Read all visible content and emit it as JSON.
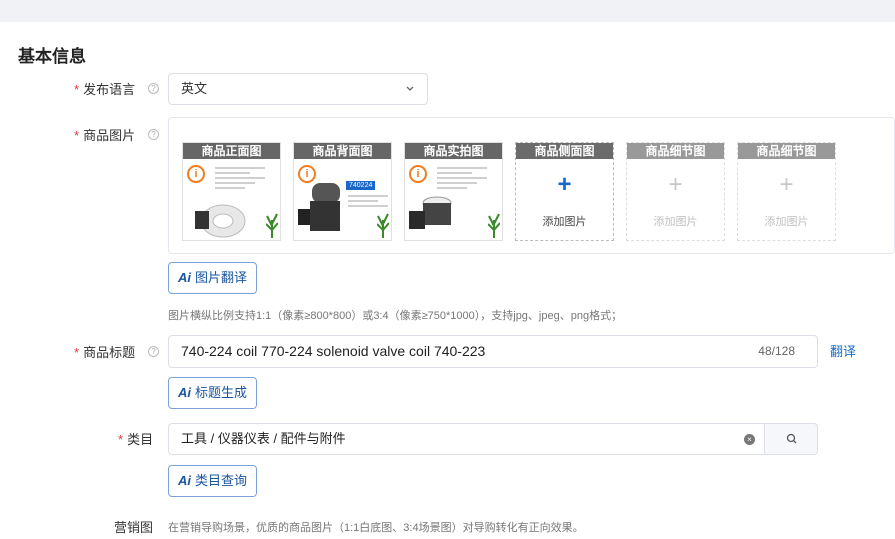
{
  "section": {
    "title": "基本信息"
  },
  "language": {
    "label": "发布语言",
    "value": "英文"
  },
  "images": {
    "label": "商品图片",
    "slots": [
      {
        "title": "商品正面图",
        "state": "filled"
      },
      {
        "title": "商品背面图",
        "state": "filled",
        "badge": "740224"
      },
      {
        "title": "商品实拍图",
        "state": "filled"
      },
      {
        "title": "商品侧面图",
        "state": "empty",
        "add_label": "添加图片"
      },
      {
        "title": "商品细节图",
        "state": "disabled",
        "add_label": "添加图片"
      },
      {
        "title": "商品细节图",
        "state": "disabled",
        "add_label": "添加图片"
      }
    ],
    "ai_button": "图片翻译",
    "hint": "图片横纵比例支持1:1（像素≥800*800）或3:4（像素≥750*1000），支持jpg、jpeg、png格式；"
  },
  "product_title": {
    "label": "商品标题",
    "value": "740-224 coil 770-224 solenoid valve coil 740-223",
    "counter": "48/128",
    "translate_link": "翻译",
    "ai_button": "标题生成"
  },
  "category": {
    "label": "类目",
    "value": "工具 / 仪器仪表 / 配件与附件",
    "ai_button": "类目查询"
  },
  "marketing": {
    "label": "营销图",
    "hint": "在营销导购场景，优质的商品图片（1:1白底图、3:4场景图）对导购转化有正向效果。"
  },
  "icons": {
    "ai": "Ai",
    "plus": "+",
    "info": "i",
    "help": "?",
    "clear": "×"
  },
  "colors": {
    "accent": "#1a66c9",
    "required": "#e4393c",
    "warning": "#f07c1f"
  }
}
